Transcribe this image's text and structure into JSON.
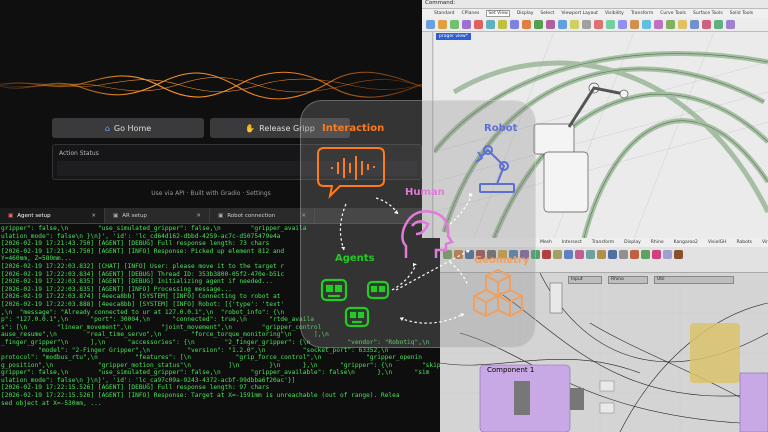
{
  "gradio": {
    "go_home_label": "Go Home",
    "release_label": "Release Gripp",
    "action_status_label": "Action Status",
    "footer": "Use via API  ·  Built with Gradio  ·  Settings"
  },
  "terminal": {
    "tabs": [
      {
        "label": "Agent setup"
      },
      {
        "label": "AR setup"
      },
      {
        "label": "Robot connection"
      }
    ],
    "lines": [
      "gripper\": false,\\n        \"use_simulated_gripper\": false,\\n        \"gripper_availa",
      "ulation_mode\": false\\n }\\n}', 'id': 'lc_cd64d162-dbbd-4259-ac7c-d5075479e4a",
      "[2026-02-19 17:21:43.750] [AGENT] [DEBUG] Full response length: 73 chars",
      "[2026-02-19 17:21:43.750] [AGENT] [INFO] Response: Picked up element 812 and",
      "Y=460mm, Z=580mm...",
      "[2026-02-19 17:22:03.832] [CHAT] [INFO] User: please move it to the target r",
      "[2026-02-19 17:22:03.834] [AGENT] [DEBUG] Thread ID: 353b3800-05f2-470e-b51c",
      "[2026-02-19 17:22:03.835] [AGENT] [DEBUG] Initializing agent if needed...",
      "[2026-02-19 17:22:03.835] [AGENT] [INFO] Processing message...",
      "[2026-02-19 17:22:03.874] [4eeca8bb] [SYSTEM] [INFO] Connecting to robot at",
      "[2026-02-19 17:22:03.888] [4eeca8bb] [SYSTEM] [INFO] Robot: [{'type': 'text'",
      ",\\n  \"message\": \"Already connected to ur at 127.0.0.1\",\\n  \"robot_info\": {\\n",
      "p\": \"127.0.0.1\",\\n      \"port\": 30004,\\n      \"connected\": true,\\n      \"rtde_availa",
      "s\": [\\n        \"linear_movement\",\\n        \"joint_movement\",\\n        \"gripper_control",
      "ause_resume\",\\n        \"real_time_servo\",\\n        \"force_torque_monitoring\"\\n      ],\\n",
      "_finger_gripper\"\\n      ],\\n      \"accessories\": {\\n        \"2_finger_gripper\": {\\n          \"vendor\": \"Robotiq\",\\n",
      "          \"model\": \"2-Finger Gripper\",\\n          \"version\": \"1.2.0\",\\n          \"socket_port\": 63352,\\n",
      "protocol\": \"modbus_rtu\",\\n          \"features\": [\\n            \"grip_force_control\",\\n            \"gripper_openin",
      "g_position\",\\n            \"gripper_motion_status\"\\n          ]\\n        }\\n      },\\n      \"gripper\": {\\n        \"skip_",
      "gripper\": false,\\n        \"use_simulated_gripper\": false,\\n        \"gripper_available\": false\\n      },\\n      \"sim",
      "ulation_mode\": false\\n }\\n}', 'id': 'lc_ca97c09a-9243-4372-acbf-99dbba6f20ac'}]",
      "[2026-02-19 17:22:15.526] [AGENT] [DEBUG] Full response length: 97 chars",
      "[2026-02-19 17:22:15.526] [AGENT] [INFO] Response: Target at X=-1591mm is unreachable (out of range). Relea",
      "sed object at X=-530mm, ..."
    ]
  },
  "rhino": {
    "command_label": "Command:",
    "menu": [
      "Standard",
      "CPlanes",
      "Set View",
      "Display",
      "Select",
      "Viewport Layout",
      "Visibility",
      "Transform",
      "Curve Tools",
      "Surface Tools",
      "Solid Tools"
    ],
    "viewport_tab": "prager view*"
  },
  "grasshopper": {
    "menu": [
      "Mesh",
      "Intersect",
      "Transform",
      "Display",
      "Rhino",
      "Kangaroo2",
      "VisiolGH",
      "Robots",
      "VirtualRobot"
    ],
    "selectors": [
      "Input",
      "Rhino",
      "Util"
    ],
    "group_label": "Component 1"
  },
  "diagram": {
    "labels": {
      "interaction": "Interaction",
      "robot": "Robot",
      "human": "Human",
      "agents": "Agents",
      "geometry": "Geometry"
    },
    "colors": {
      "interaction": "#ff7a1a",
      "robot": "#5b6fd6",
      "human": "#e07bd8",
      "agents": "#22cc22",
      "geometry": "#f0a060"
    },
    "icons": [
      "waveform-speech-bubble-icon",
      "robot-arm-icon",
      "human-head-icon",
      "agents-robot-faces-icon",
      "cubes-icon"
    ]
  }
}
